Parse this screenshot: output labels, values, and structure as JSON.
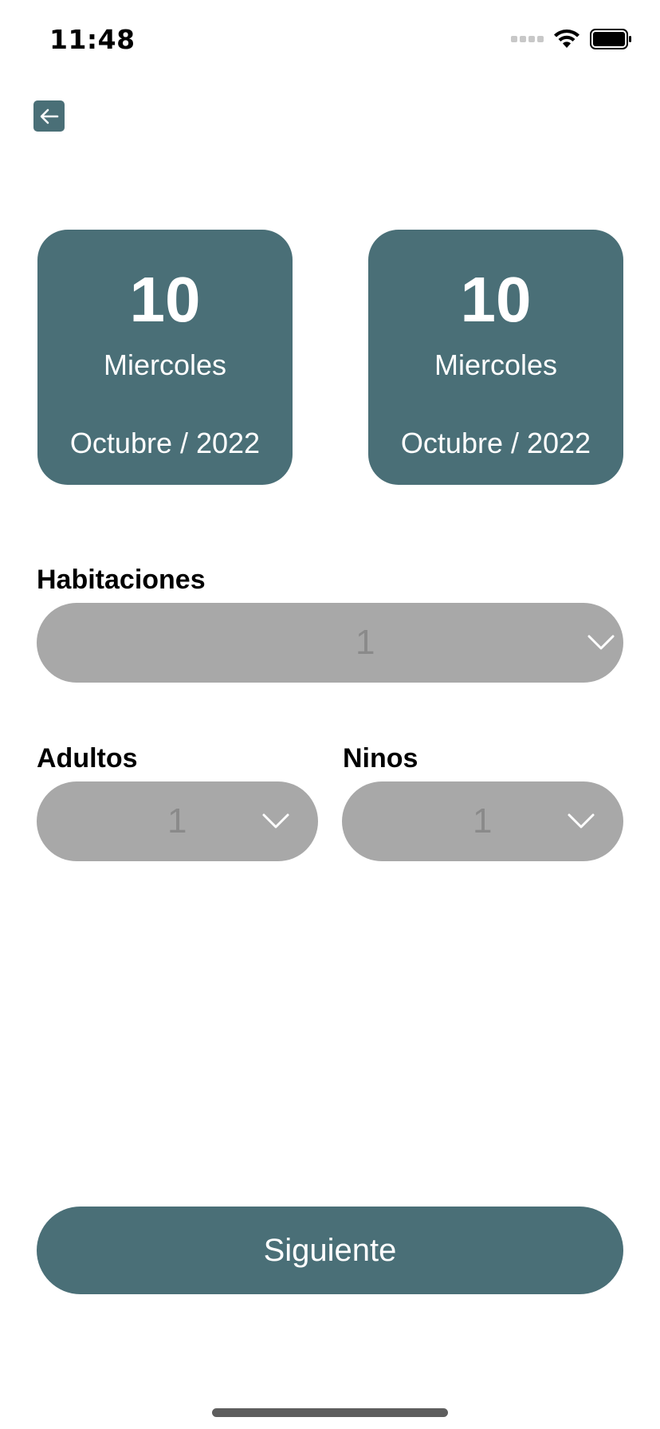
{
  "status_bar": {
    "time": "11:48"
  },
  "header": {
    "back_icon": "arrow-left-icon"
  },
  "dates": [
    {
      "day": "10",
      "weekday": "Miercoles",
      "month_year": "Octubre / 2022"
    },
    {
      "day": "10",
      "weekday": "Miercoles",
      "month_year": "Octubre / 2022"
    }
  ],
  "rooms": {
    "label": "Habitaciones",
    "value": "1"
  },
  "adults": {
    "label": "Adultos",
    "value": "1"
  },
  "children": {
    "label": "Ninos",
    "value": "1"
  },
  "next_button": {
    "label": "Siguiente"
  },
  "colors": {
    "accent": "#4a6f77",
    "select_bg": "#a8a8a8",
    "select_text": "#8a8a8a"
  }
}
